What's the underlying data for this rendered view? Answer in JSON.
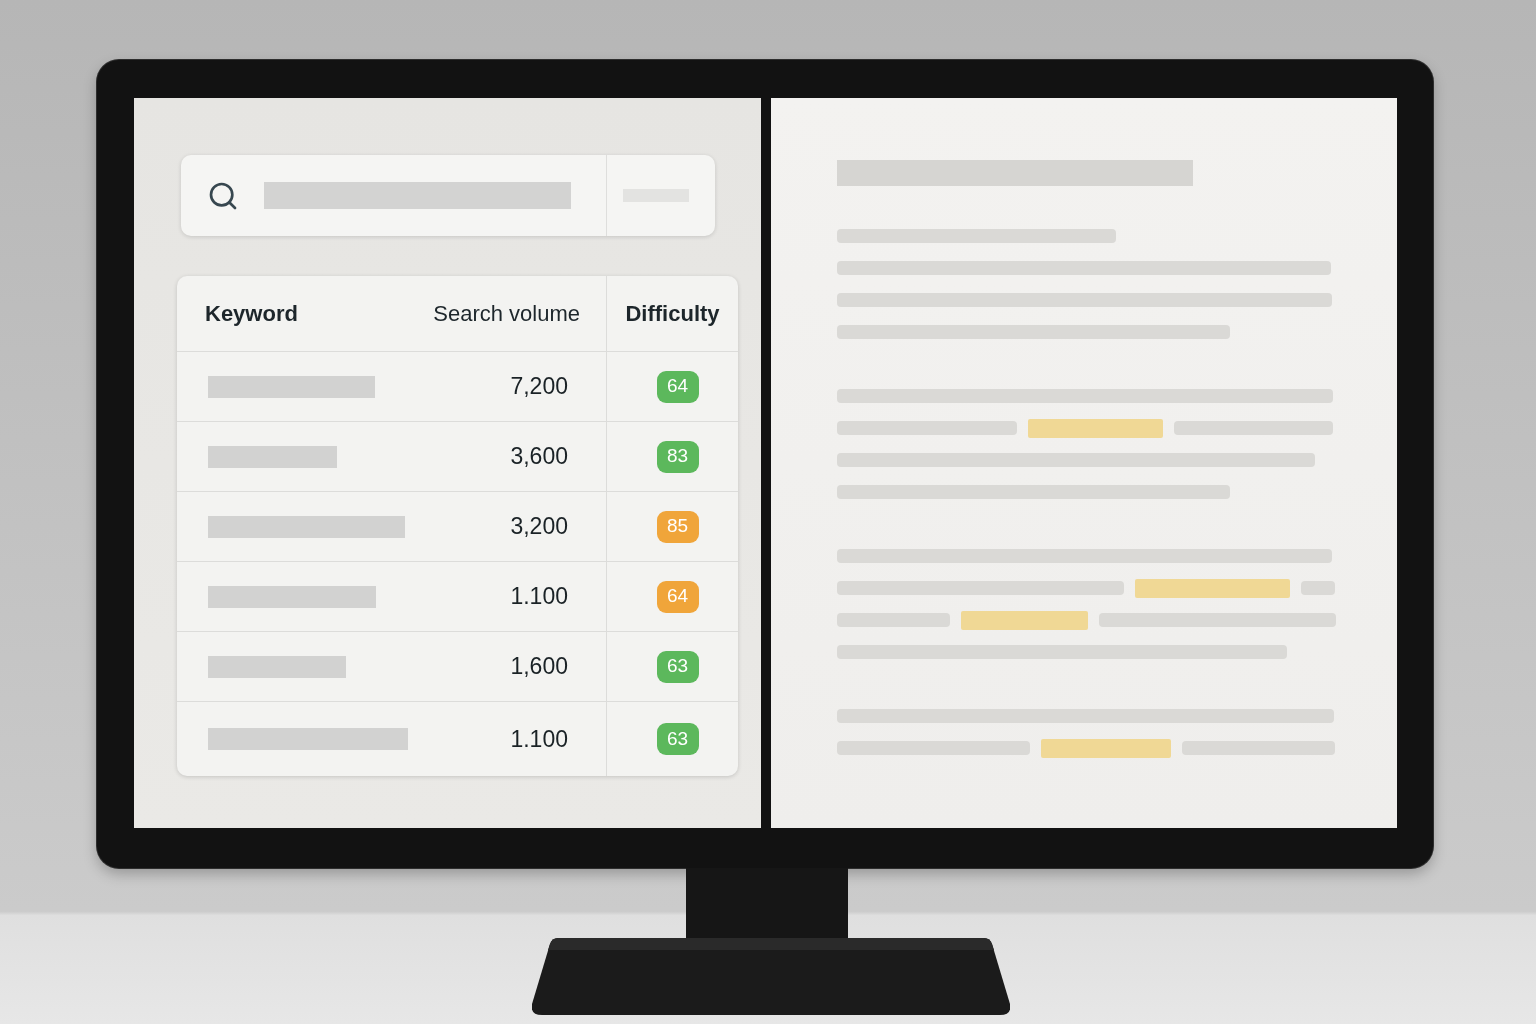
{
  "table": {
    "columns": [
      "Keyword",
      "Search volume",
      "Difficulty"
    ],
    "rows": [
      {
        "search_volume": "7,200",
        "difficulty": "64",
        "color": "#5cb85c"
      },
      {
        "search_volume": "3,600",
        "difficulty": "83",
        "color": "#5cb85c"
      },
      {
        "search_volume": "3,200",
        "difficulty": "85",
        "color": "#f0a53a"
      },
      {
        "search_volume": "1.100",
        "difficulty": "64",
        "color": "#f0a53a"
      },
      {
        "search_volume": "1,600",
        "difficulty": "63",
        "color": "#5cb85c"
      },
      {
        "search_volume": "1.100",
        "difficulty": "63",
        "color": "#5cb85c"
      }
    ]
  }
}
